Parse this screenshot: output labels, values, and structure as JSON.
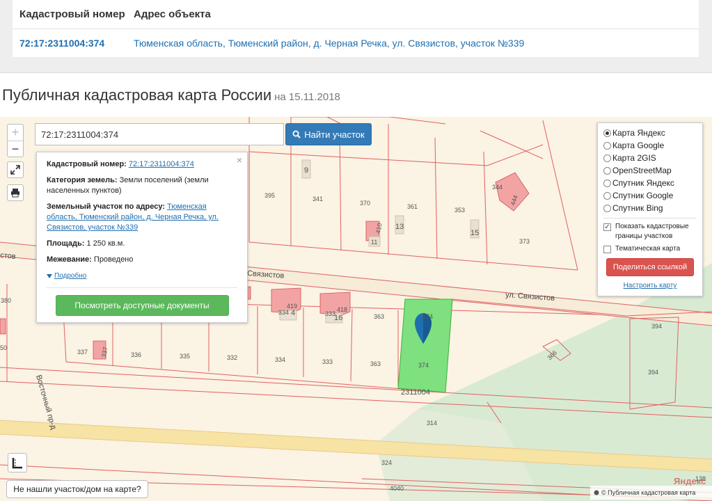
{
  "top_table": {
    "col_number": "Кадастровый номер",
    "col_address": "Адрес объекта",
    "row_number": "72:17:2311004:374",
    "row_address": "Тюменская область, Тюменский район, д. Черная Речка, ул. Связистов, участок №339"
  },
  "title": {
    "main": "Публичная кадастровая карта России",
    "date": "на 15.11.2018"
  },
  "map": {
    "zoom_in": "+",
    "zoom_out": "−",
    "search_value": "72:17:2311004:374",
    "search_button": "Найти участок",
    "popup": {
      "number_label": "Кадастровый номер:",
      "number_value": "72:17:2311004:374",
      "category_label": "Категория земель:",
      "category_value": "Земли поселений (земли населенных пунктов)",
      "address_label": "Земельный участок по адресу:",
      "address_value": "Тюменская область, Тюменский район, д. Черная Речка, ул. Связистов, участок №339",
      "area_label": "Площадь:",
      "area_value": "1 250 кв.м.",
      "survey_label": "Межевание:",
      "survey_value": "Проведено",
      "more": "Подробно",
      "docs_button": "Посмотреть доступные документы",
      "close": "×"
    },
    "layers": {
      "options": [
        "Карта Яндекс",
        "Карта Google",
        "Карта 2GIS",
        "OpenStreetMap",
        "Спутник Яндекс",
        "Спутник Google",
        "Спутник Bing"
      ],
      "show_borders": "Показать кадастровые границы участков",
      "thematic": "Тематическая карта",
      "share": "Поделиться ссылкой",
      "setup": "Настроить карту"
    },
    "not_found": "Не нашли участок/дом на карте?",
    "copyright": "© Публичная кадастровая карта",
    "yandex": "Яндекс",
    "streets": {
      "main_1": "ул. Связистов",
      "main_2": "Связистов",
      "side": "Восточный пр-д",
      "left": "стов"
    },
    "parcel_labels": {
      "p9": "9",
      "p341": "341",
      "p395": "395",
      "p370": "370",
      "p361": "361",
      "p13": "13",
      "p353": "353",
      "p15": "15",
      "p344": "344",
      "p373": "373",
      "p11": "11",
      "p410": "410",
      "p444": "444",
      "p334": "334",
      "p4": "4",
      "p419": "419",
      "p333": "333",
      "p16": "16",
      "p418": "418",
      "p363": "363",
      "p374": "374",
      "p337": "337",
      "p337b": "337",
      "p336": "336",
      "p335": "335",
      "p332": "332",
      "p334b": "334",
      "p333b": "333",
      "p363b": "363",
      "p374b": "374",
      "p366": "366",
      "p394": "394",
      "p394b": "394",
      "p314": "314",
      "p324": "324",
      "p4040": "4040",
      "p380": "380",
      "p50": "50",
      "quarter": "2311004",
      "p138": "138"
    }
  },
  "colors": {
    "parcel_border": "#e06060",
    "selected_parcel": "#7ee07e",
    "road": "#f7e3a4",
    "green_area": "#d9ead3",
    "building": "#f2a4a4",
    "marker": "#1f6fb0"
  }
}
